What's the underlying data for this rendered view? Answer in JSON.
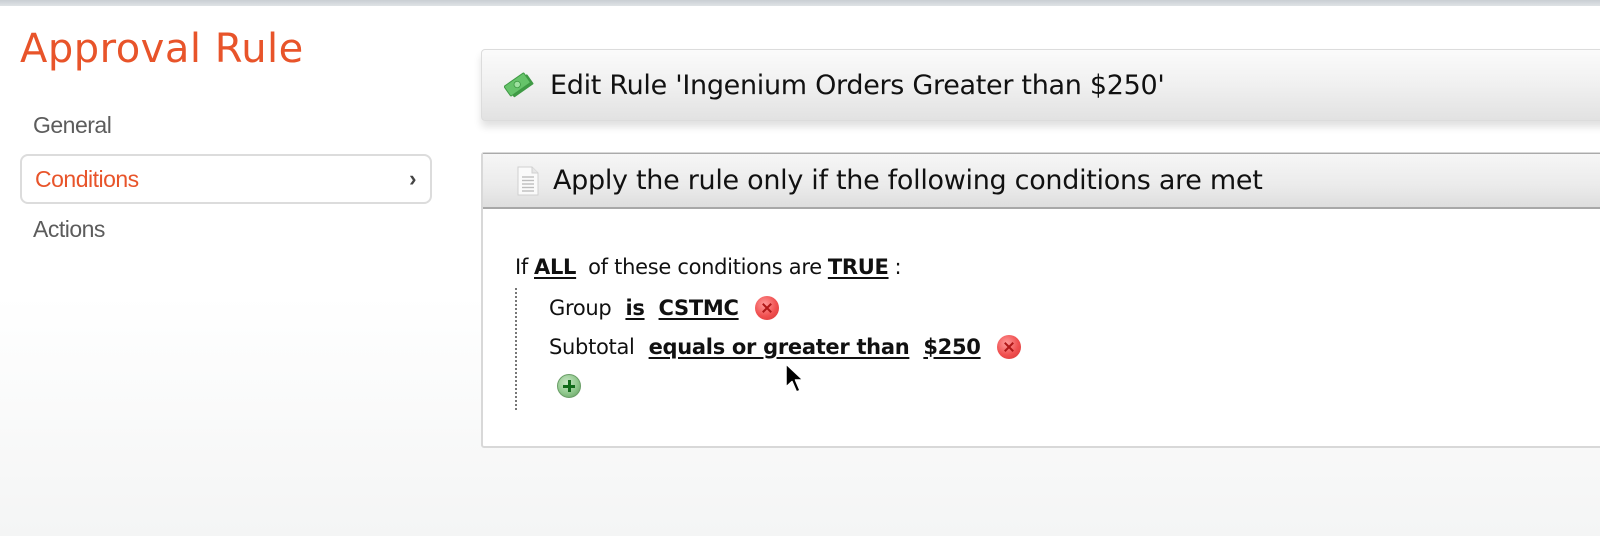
{
  "page": {
    "title": "Approval Rule"
  },
  "nav": {
    "items": [
      {
        "label": "General",
        "active": false
      },
      {
        "label": "Conditions",
        "active": true
      },
      {
        "label": "Actions",
        "active": false
      }
    ]
  },
  "header": {
    "icon": "money-icon",
    "title": "Edit Rule 'Ingenium Orders Greater than $250'"
  },
  "conditions_panel": {
    "icon": "document-icon",
    "title": "Apply the rule only if the following conditions are met",
    "intro": {
      "prefix": "If",
      "aggregator": "ALL",
      "middle": "of these conditions are",
      "value": "TRUE",
      "suffix": ":"
    },
    "conditions": [
      {
        "field": "Group",
        "operator": "is",
        "value": "CSTMC"
      },
      {
        "field": "Subtotal",
        "operator": "equals or greater than",
        "value": "$250"
      }
    ]
  },
  "colors": {
    "accent": "#e8542a",
    "delete": "#f05050",
    "add": "#5e9a5b"
  }
}
